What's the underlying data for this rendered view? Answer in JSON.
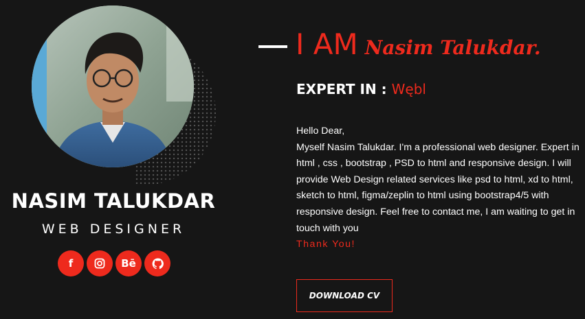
{
  "profile": {
    "name": "NASIM TALUKDAR",
    "role": "WEB DESIGNER"
  },
  "socials": [
    {
      "icon": "facebook-icon",
      "glyph": "f"
    },
    {
      "icon": "instagram-icon",
      "glyph": ""
    },
    {
      "icon": "behance-icon",
      "glyph": "Bē"
    },
    {
      "icon": "github-icon",
      "glyph": ""
    }
  ],
  "intro": {
    "prefix": "I AM",
    "name": "Nasim Talukdar.",
    "expert_label": "EXPERT IN :",
    "expert_value": "Wębl"
  },
  "bio": {
    "greeting": "Hello Dear,",
    "body": "Myself Nasim Talukdar. I'm a professional web designer. Expert in html , css , bootstrap , PSD to html and responsive design. I will provide Web Design related services like psd to html, xd to html, sketch to html, figma/zeplin to html using bootstrap4/5 with responsive design. Feel free to contact me, I am waiting to get in touch with you",
    "thanks": "Thank You!"
  },
  "cta": {
    "download_label": "DOWNLOAD CV"
  },
  "colors": {
    "accent": "#ee2a1d",
    "background": "#161616",
    "text": "#ffffff"
  }
}
